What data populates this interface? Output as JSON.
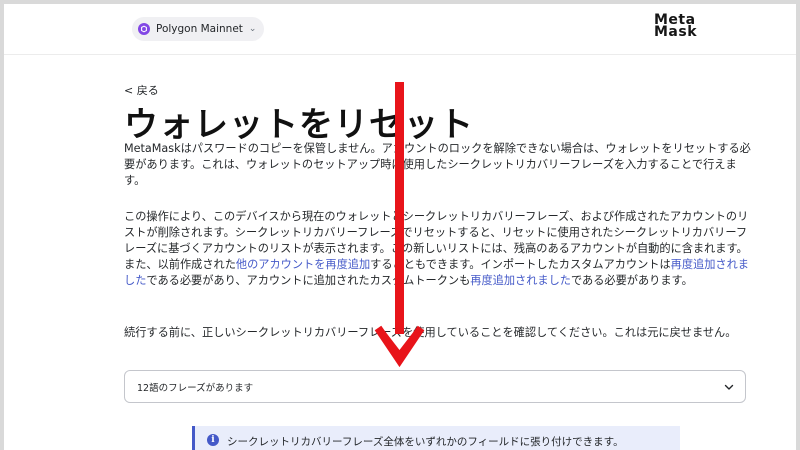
{
  "header": {
    "network_label": "Polygon Mainnet",
    "logo_line1": "Meta",
    "logo_line2": "Mask"
  },
  "main": {
    "back_label": "< 戻る",
    "title": "ウォレットをリセット",
    "para1": "MetaMaskはパスワードのコピーを保管しません。アカウントのロックを解除できない場合は、ウォレットをリセットする必要があります。これは、ウォレットのセットアップ時に使用したシークレットリカバリーフレーズを入力することで行えます。",
    "para2": {
      "text_a": "この操作により、このデバイスから現在のウォレットとシークレットリカバリーフレーズ、および作成されたアカウントのリストが削除されます。シークレットリカバリーフレーズでリセットすると、リセットに使用されたシークレットリカバリーフレーズに基づくアカウントのリストが表示されます。この新しいリストには、残高のあるアカウントが自動的に含まれます。また、以前作成された",
      "link_1": "他のアカウントを再度追加",
      "text_b": "することもできます。インポートしたカスタムアカウントは",
      "link_2": "再度追加されました",
      "text_c": "である必要があり、アカウントに追加されたカスタムトークンも",
      "link_3": "再度追加されました",
      "text_d": "である必要があります。"
    },
    "para3": "続行する前に、正しいシークレットリカバリーフレーズを使用していることを確認してください。これは元に戻せません。",
    "phrase_select": "12語のフレーズがあります",
    "banner_text": "シークレットリカバリーフレーズ全体をいずれかのフィールドに張り付けできます。"
  },
  "icons": {
    "network": "polygon-icon",
    "dropdown": "chevron-down-icon",
    "info": "info-icon",
    "annotation": "red-down-arrow"
  },
  "colors": {
    "link": "#4459c8",
    "network": "#8247e5",
    "arrow": "#e8141a",
    "banner_bg": "#e9edfb"
  }
}
